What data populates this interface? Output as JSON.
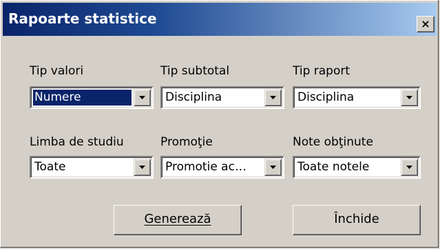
{
  "window": {
    "title": "Rapoarte statistice",
    "close_glyph": "×"
  },
  "filters": [
    {
      "label": "Tip valori",
      "value": "Numere",
      "selected": true
    },
    {
      "label": "Tip subtotal",
      "value": "Disciplina"
    },
    {
      "label": "Tip raport",
      "value": "Disciplina"
    },
    {
      "label": "Limba de studiu",
      "value": "Toate"
    },
    {
      "label": "Promoţie",
      "value": "Promotie ac…"
    },
    {
      "label": "Note obţinute",
      "value": "Toate notele"
    }
  ],
  "buttons": {
    "generate": "Generează",
    "close": "Închide"
  },
  "icons": {
    "dropdown": "chevron-down-icon",
    "close": "close-icon"
  },
  "colors": {
    "title_start": "#0a246a",
    "title_end": "#a6caf0",
    "face": "#d4d0c8",
    "selection": "#0a246a"
  }
}
